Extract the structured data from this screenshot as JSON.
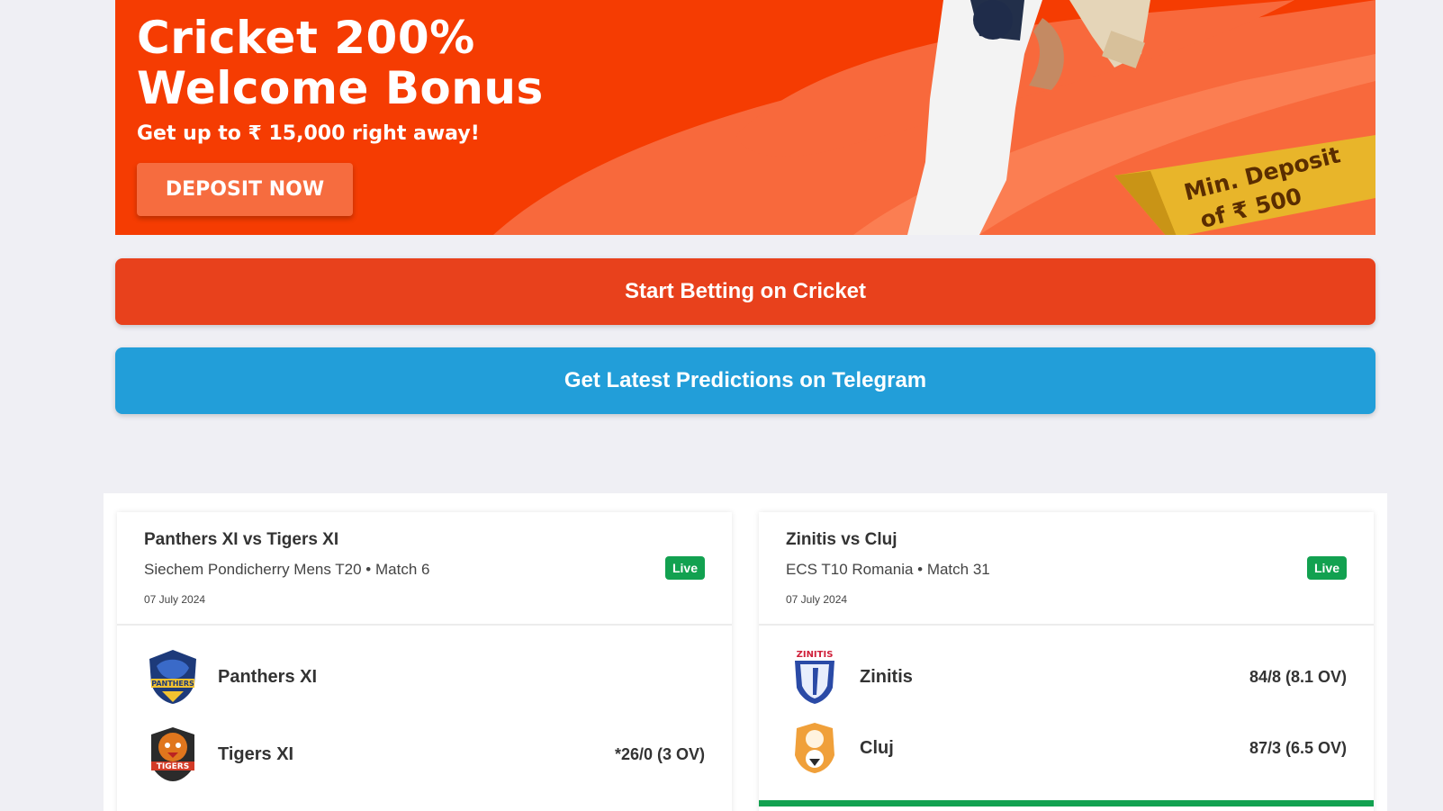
{
  "banner": {
    "title_line1": "Cricket 200%",
    "title_line2": "Welcome Bonus",
    "subtitle": "Get up to ₹ 15,000 right away!",
    "cta_label": "DEPOSIT NOW",
    "ribbon_line1": "Min. Deposit",
    "ribbon_line2": "of ₹ 500"
  },
  "actions": {
    "cricket_label": "Start Betting on Cricket",
    "telegram_label": "Get Latest Predictions on Telegram"
  },
  "colors": {
    "banner_orange": "#f53c02",
    "cricket_bar": "#e8411c",
    "telegram_bar": "#229ed9",
    "live_green": "#12a150"
  },
  "matches": [
    {
      "title": "Panthers XI vs Tigers XI",
      "league": "Siechem Pondicherry Mens T20 • Match 6",
      "date": "07 July 2024",
      "status": "Live",
      "teams": [
        {
          "name": "Panthers XI",
          "score": "",
          "logo": "panthers-logo-icon"
        },
        {
          "name": "Tigers XI",
          "score": "*26/0 (3 OV)",
          "logo": "tigers-logo-icon"
        }
      ]
    },
    {
      "title": "Zinitis vs Cluj",
      "league": "ECS T10 Romania • Match 31",
      "date": "07 July 2024",
      "status": "Live",
      "teams": [
        {
          "name": "Zinitis",
          "score": "84/8 (8.1 OV)",
          "logo": "zinitis-logo-icon"
        },
        {
          "name": "Cluj",
          "score": "87/3 (6.5 OV)",
          "logo": "cluj-logo-icon"
        }
      ]
    }
  ]
}
